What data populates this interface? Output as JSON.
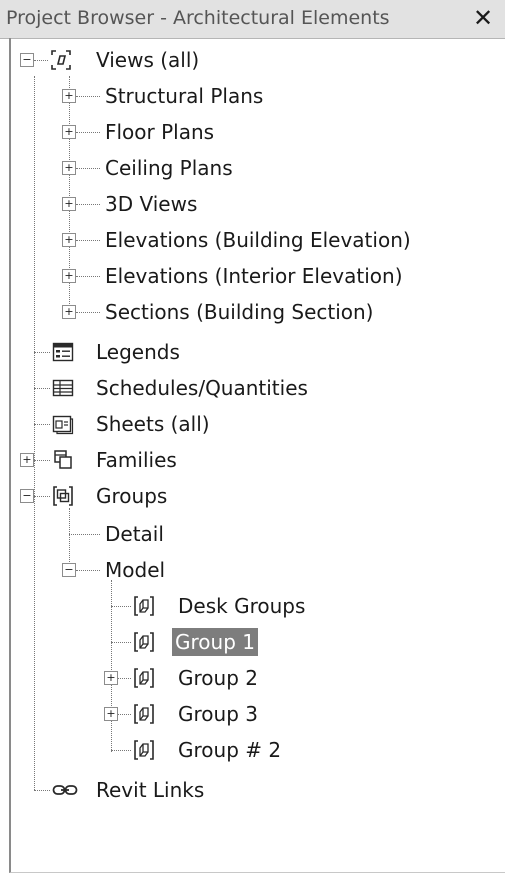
{
  "panel": {
    "title": "Project Browser - Architectural Elements",
    "close_glyph": "✕"
  },
  "tree": {
    "views": {
      "label": "Views (all)",
      "icon": "views-icon",
      "children": [
        "Structural Plans",
        "Floor Plans",
        "Ceiling Plans",
        "3D Views",
        "Elevations (Building Elevation)",
        "Elevations (Interior Elevation)",
        "Sections (Building Section)"
      ]
    },
    "legends": {
      "label": "Legends",
      "icon": "legend-icon"
    },
    "schedules": {
      "label": "Schedules/Quantities",
      "icon": "schedule-icon"
    },
    "sheets": {
      "label": "Sheets (all)",
      "icon": "sheet-icon"
    },
    "families": {
      "label": "Families",
      "icon": "families-icon"
    },
    "groups": {
      "label": "Groups",
      "icon": "groups-icon",
      "detail": "Detail",
      "model": {
        "label": "Model",
        "items": [
          "Desk Groups",
          "Group 1",
          "Group 2",
          "Group 3",
          "Group # 2"
        ],
        "selected": "Group 1"
      }
    },
    "revit_links": {
      "label": "Revit Links",
      "icon": "link-icon"
    }
  },
  "colors": {
    "selection_bg": "#7d7d7d",
    "titlebar_bg": "#e2e2e2"
  }
}
